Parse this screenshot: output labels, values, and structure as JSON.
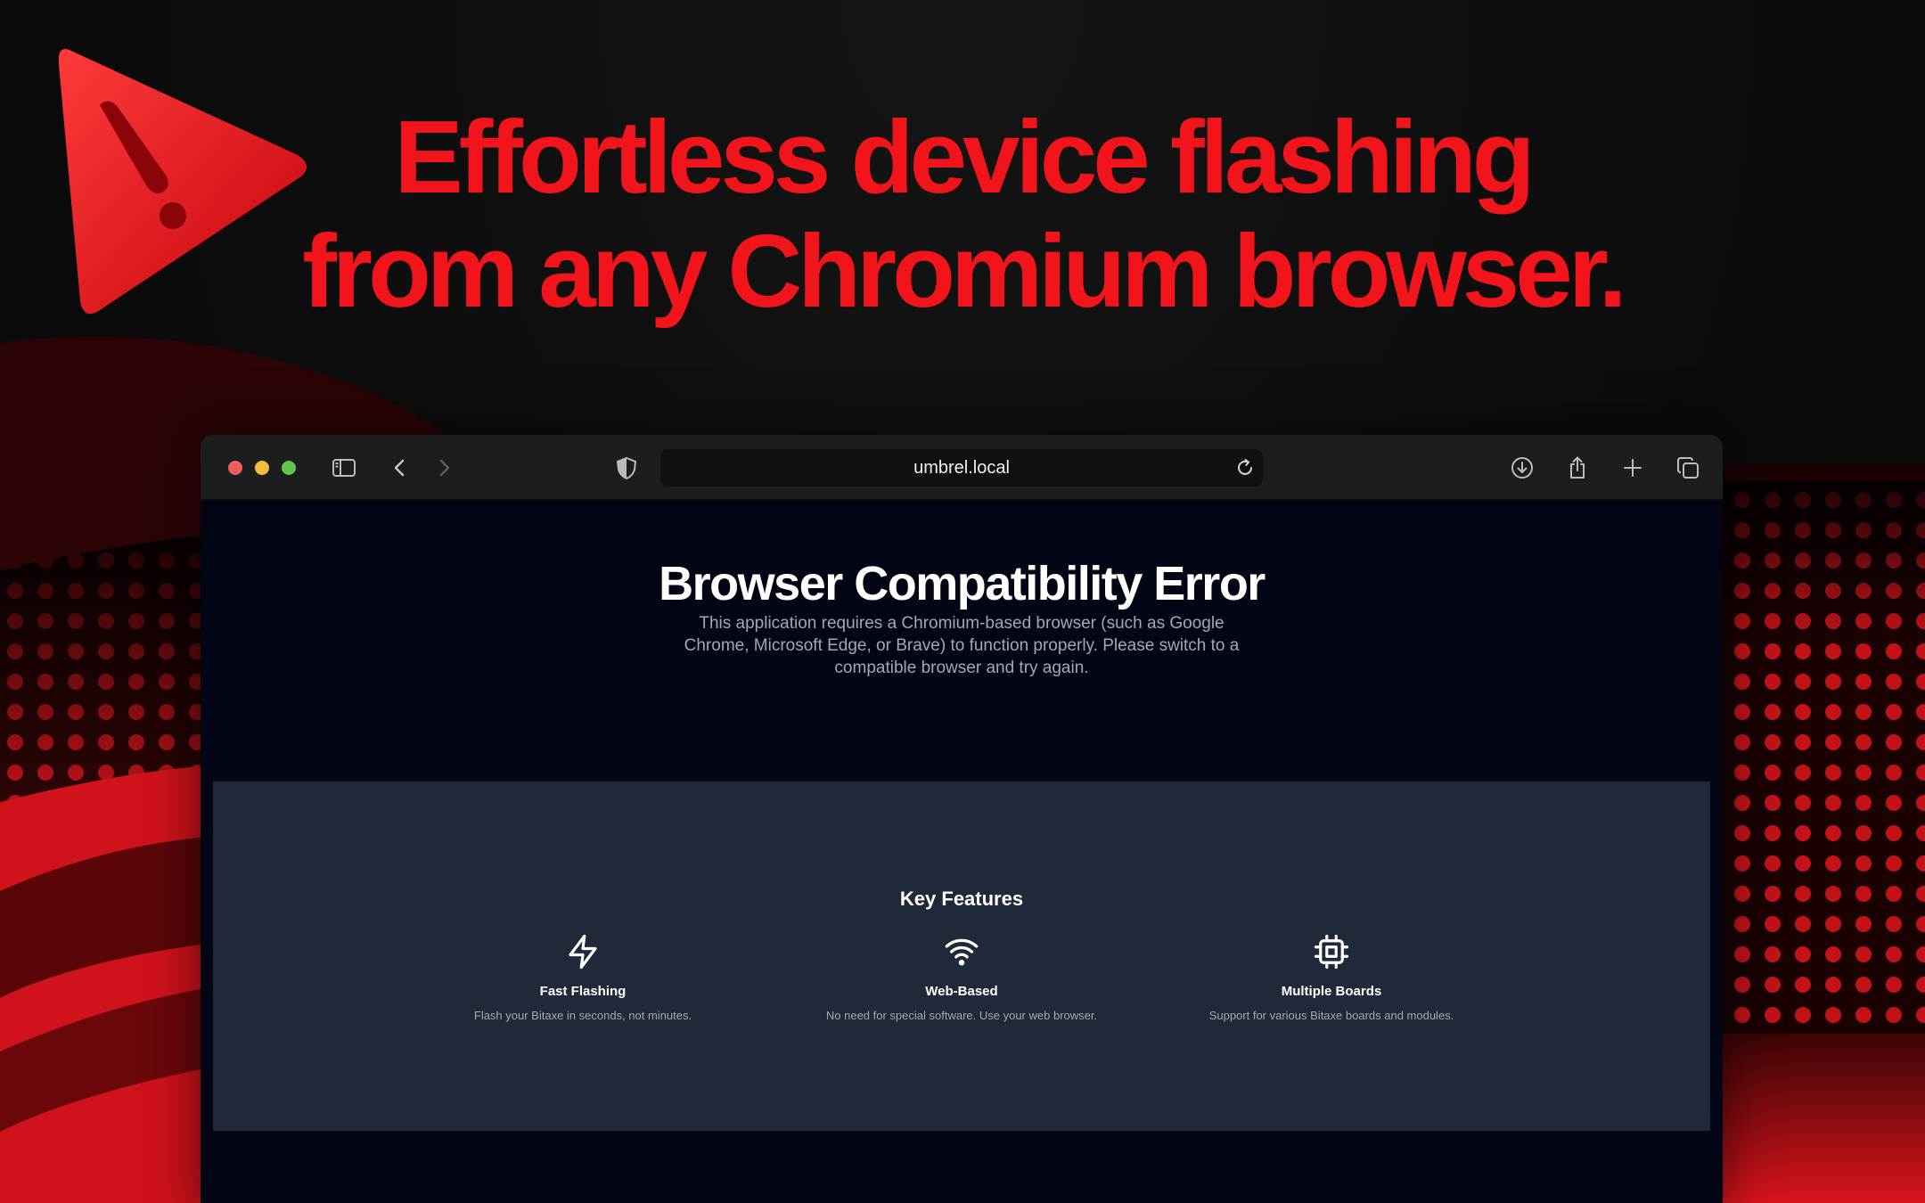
{
  "headline": {
    "line1": "Effortless device flashing",
    "line2": "from any Chromium browser."
  },
  "browser": {
    "url": "umbrel.local",
    "toolbar_icons": [
      "sidebar-icon",
      "back-icon",
      "forward-icon",
      "shield-icon",
      "reload-icon",
      "download-icon",
      "share-icon",
      "new-tab-icon",
      "tabs-overview-icon"
    ]
  },
  "page": {
    "title": "Browser Compatibility Error",
    "description": "This application requires a Chromium-based browser (such as Google Chrome, Microsoft Edge, or Brave) to function properly. Please switch to a compatible browser and try again.",
    "features": {
      "title": "Key Features",
      "items": [
        {
          "icon": "lightning-icon",
          "name": "Fast Flashing",
          "description": "Flash your Bitaxe in seconds, not minutes."
        },
        {
          "icon": "wifi-icon",
          "name": "Web-Based",
          "description": "No need for special software. Use your web browser."
        },
        {
          "icon": "chip-icon",
          "name": "Multiple Boards",
          "description": "Support for various Bitaxe boards and modules."
        }
      ]
    }
  },
  "colors": {
    "accent_red": "#f2141b",
    "page_bg": "#020614",
    "features_bg": "#1f2937",
    "toolbar_bg": "#1c1d1f"
  }
}
